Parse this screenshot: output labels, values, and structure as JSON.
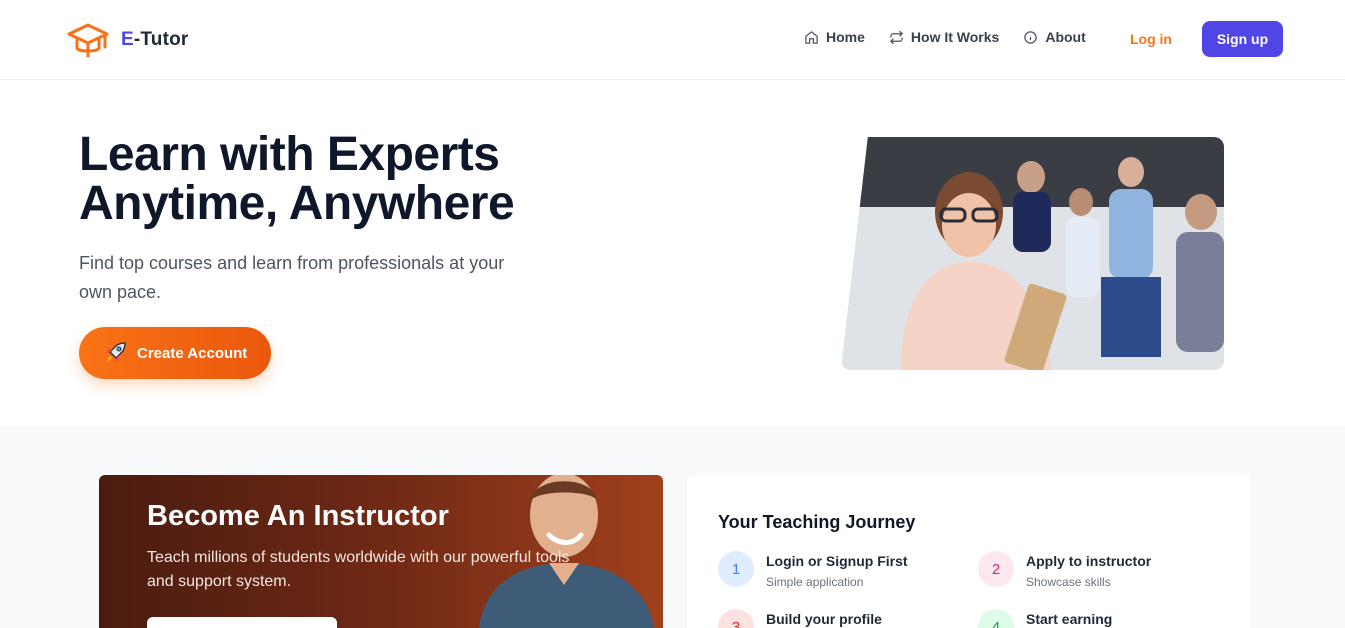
{
  "header": {
    "logo_prefix": "E",
    "logo_suffix": "-Tutor",
    "nav": [
      {
        "label": "Home",
        "icon": "home-icon"
      },
      {
        "label": "How It Works",
        "icon": "repeat-icon"
      },
      {
        "label": "About",
        "icon": "info-icon"
      }
    ],
    "login_label": "Log in",
    "signup_label": "Sign up"
  },
  "hero": {
    "title_line1": "Learn with Experts",
    "title_line2": "Anytime, Anywhere",
    "subtitle": "Find top courses and learn from professionals at your own pace.",
    "cta_label": "Create Account",
    "cta_icon": "rocket-icon"
  },
  "instructor": {
    "title": "Become An Instructor",
    "text": "Teach millions of students worldwide with our powerful tools and support system."
  },
  "journey": {
    "title": "Your Teaching Journey",
    "steps": [
      {
        "num": "1",
        "title": "Login or Signup First",
        "desc": "Simple application",
        "color": "#3b82f6",
        "bg": "#e0ecff"
      },
      {
        "num": "2",
        "title": "Apply to instructor",
        "desc": "Showcase skills",
        "color": "#db2777",
        "bg": "#fde7f1"
      },
      {
        "num": "3",
        "title": "Build your profile",
        "desc": "",
        "color": "#dc2626",
        "bg": "#fde2e2"
      },
      {
        "num": "4",
        "title": "Start earning",
        "desc": "",
        "color": "#16a34a",
        "bg": "#dcfce7"
      }
    ]
  },
  "colors": {
    "brand": "#4f46e5",
    "accent": "#f97316"
  }
}
